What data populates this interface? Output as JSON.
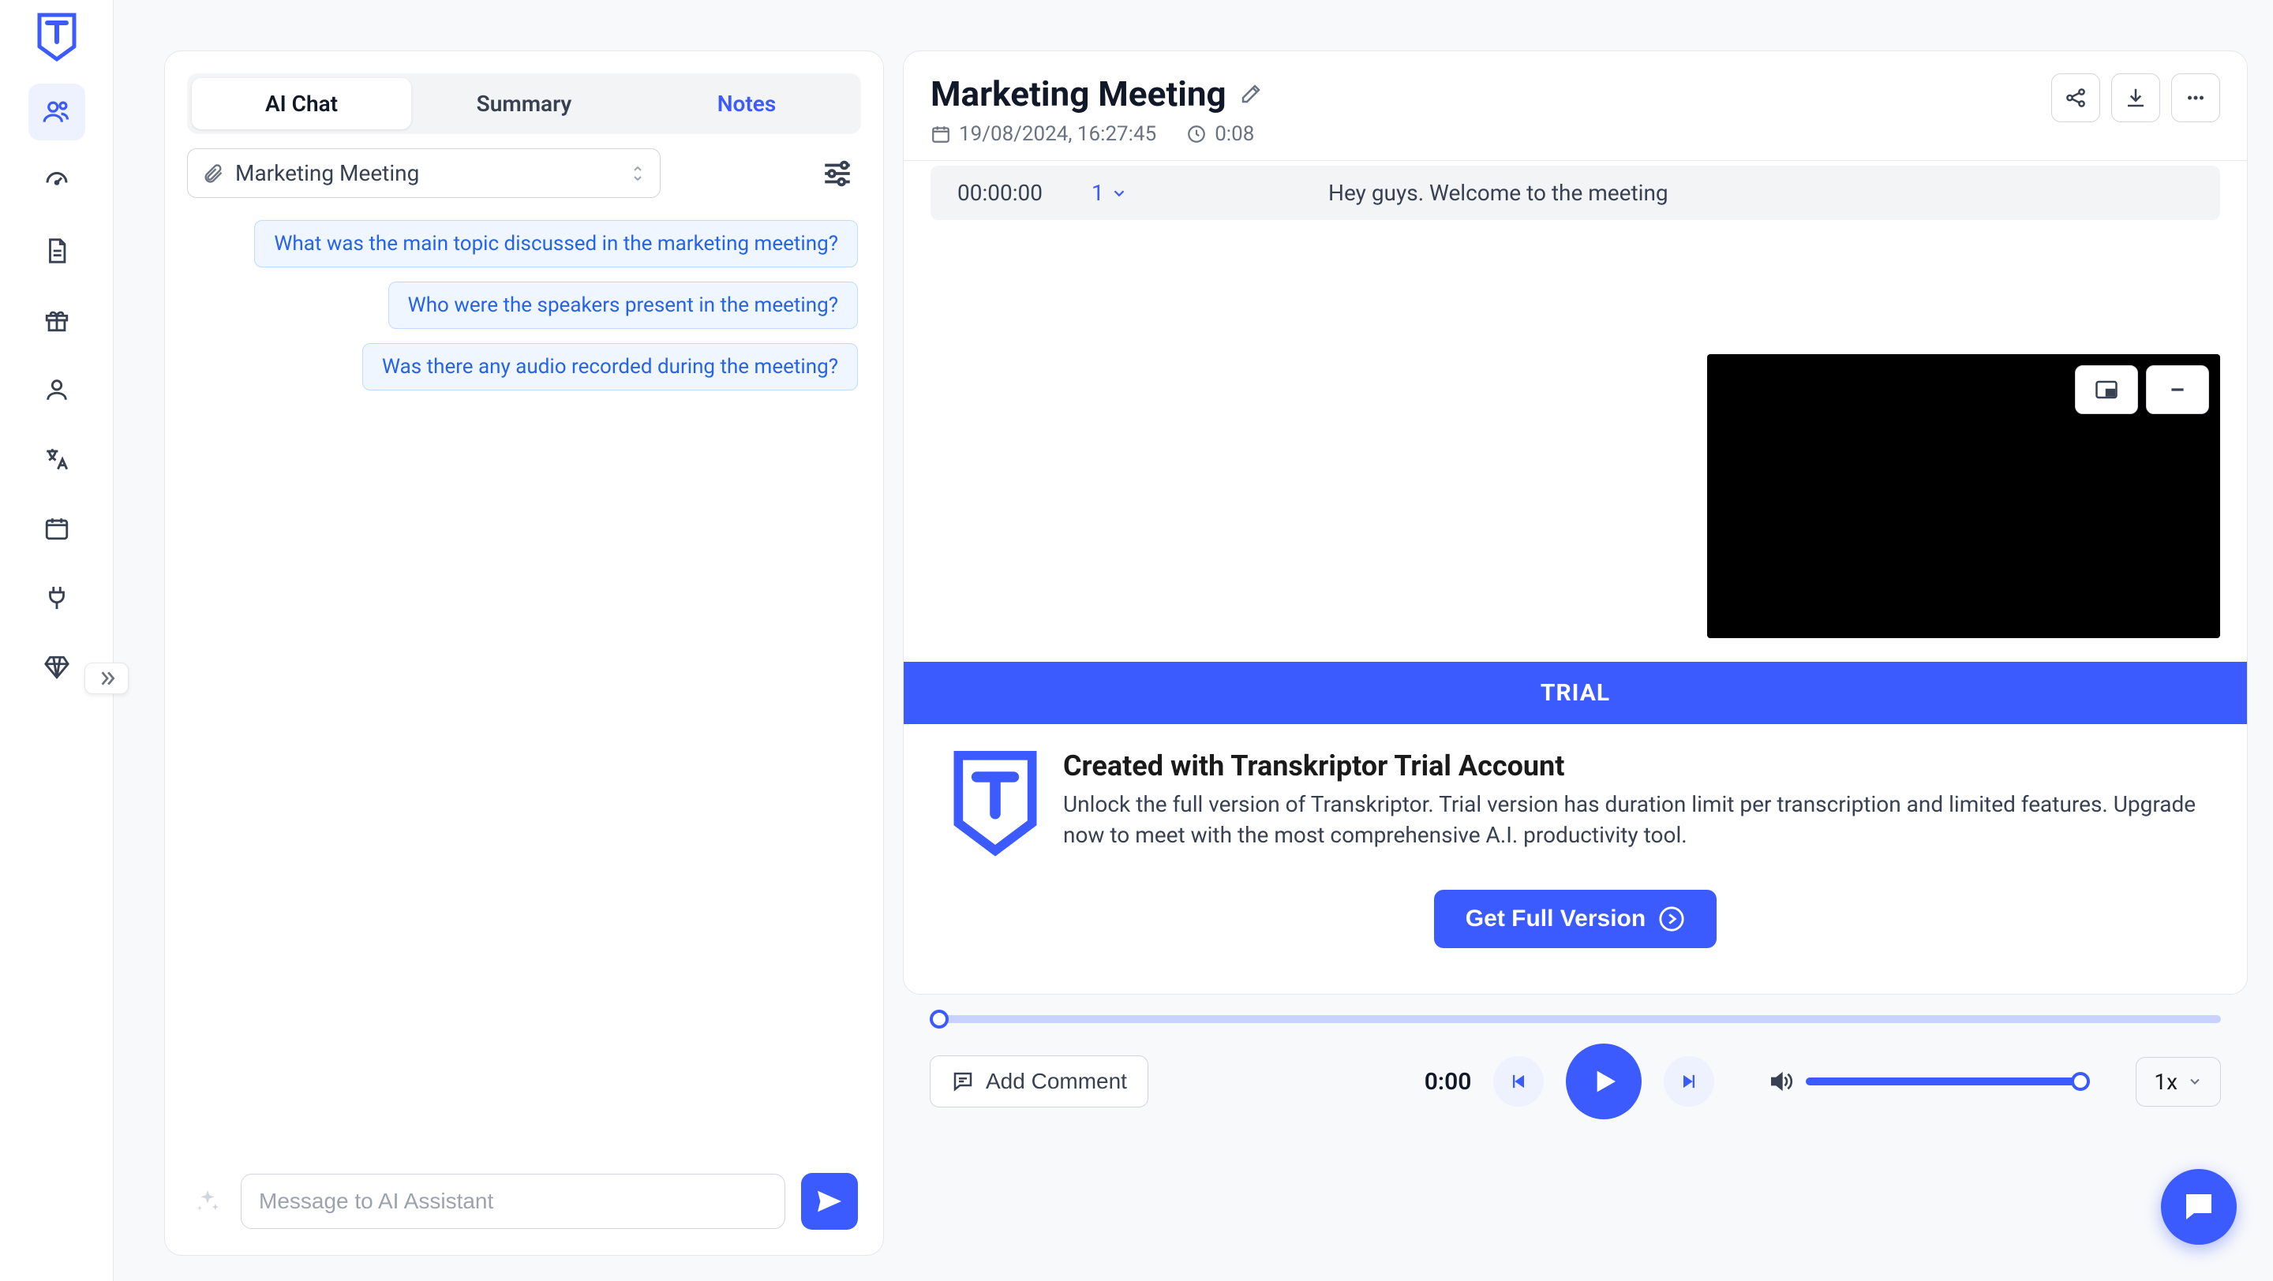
{
  "sidebar": {
    "items": [
      {
        "name": "people-icon"
      },
      {
        "name": "speed-icon"
      },
      {
        "name": "file-icon"
      },
      {
        "name": "gift-icon"
      },
      {
        "name": "user-icon"
      },
      {
        "name": "translate-icon"
      },
      {
        "name": "calendar-icon"
      },
      {
        "name": "plug-icon"
      },
      {
        "name": "diamond-icon"
      }
    ]
  },
  "left": {
    "tabs": {
      "chat": "AI Chat",
      "summary": "Summary",
      "notes": "Notes"
    },
    "meeting_select": "Marketing Meeting",
    "suggestions": [
      "What was the main topic discussed in the marketing meeting?",
      "Who were the speakers present in the meeting?",
      "Was there any audio recorded during the meeting?"
    ],
    "input_placeholder": "Message to AI Assistant"
  },
  "right": {
    "title": "Marketing Meeting",
    "date": "19/08/2024, 16:27:45",
    "duration": "0:08",
    "transcript": {
      "time": "00:00:00",
      "speaker": "1",
      "text": "Hey guys. Welcome to the meeting"
    },
    "trial": {
      "banner": "TRIAL",
      "heading": "Created with Transkriptor Trial Account",
      "body": "Unlock the full version of Transkriptor. Trial version has duration limit per transcription and limited features. Upgrade now to meet with the most comprehensive A.I. productivity tool.",
      "cta": "Get Full Version"
    }
  },
  "player": {
    "comment": "Add Comment",
    "current_time": "0:00",
    "speed": "1x"
  },
  "colors": {
    "accent": "#3b5bff"
  }
}
